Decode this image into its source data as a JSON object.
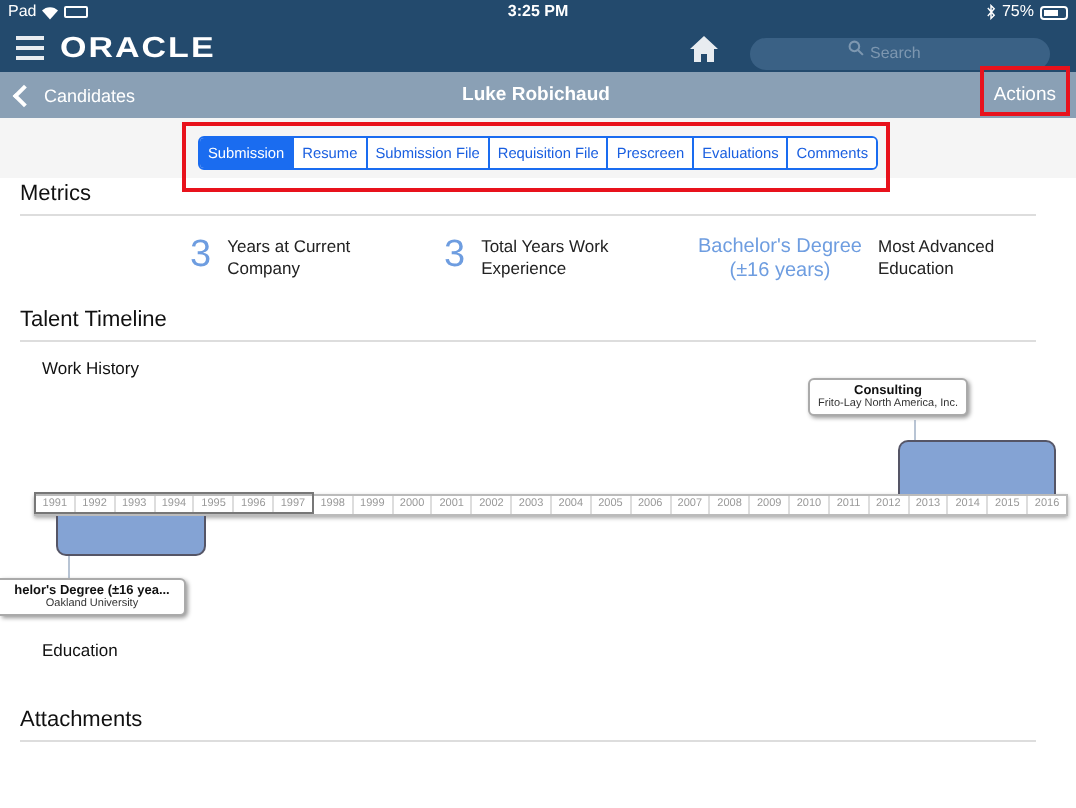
{
  "status_bar": {
    "device": "Pad",
    "time": "3:25 PM",
    "battery": "75%"
  },
  "header": {
    "logo": "ORACLE",
    "search": {
      "placeholder": "Search"
    }
  },
  "nav_bar": {
    "back": "Candidates",
    "title": "Luke  Robichaud",
    "action": "Actions"
  },
  "tabs": [
    {
      "label": "Submission",
      "selected": true
    },
    {
      "label": "Resume",
      "selected": false
    },
    {
      "label": "Submission File",
      "selected": false
    },
    {
      "label": "Requisition File",
      "selected": false
    },
    {
      "label": "Prescreen",
      "selected": false
    },
    {
      "label": "Evaluations",
      "selected": false
    },
    {
      "label": "Comments",
      "selected": false
    }
  ],
  "metrics": {
    "title": "Metrics",
    "items": [
      {
        "value": "3",
        "label": "Years at Current Company"
      },
      {
        "value": "3",
        "label": "Total Years Work Experience"
      },
      {
        "value": "Bachelor's Degree (±16 years)",
        "label": "Most Advanced Education"
      }
    ]
  },
  "timeline": {
    "title": "Talent Timeline",
    "work_label": "Work History",
    "education_label": "Education",
    "years": [
      "1991",
      "1992",
      "1993",
      "1994",
      "1995",
      "1996",
      "1997",
      "1998",
      "1999",
      "2000",
      "2001",
      "2002",
      "2003",
      "2004",
      "2005",
      "2006",
      "2007",
      "2008",
      "2009",
      "2010",
      "2011",
      "2012",
      "2013",
      "2014",
      "2015",
      "2016"
    ],
    "entries": [
      {
        "kind": "work",
        "title": "Consulting",
        "subtitle": "Frito-Lay North America, Inc."
      },
      {
        "kind": "education",
        "title": "helor's Degree (±16 yea...",
        "subtitle": "Oakland University"
      }
    ]
  },
  "attachments": {
    "title": "Attachments"
  }
}
